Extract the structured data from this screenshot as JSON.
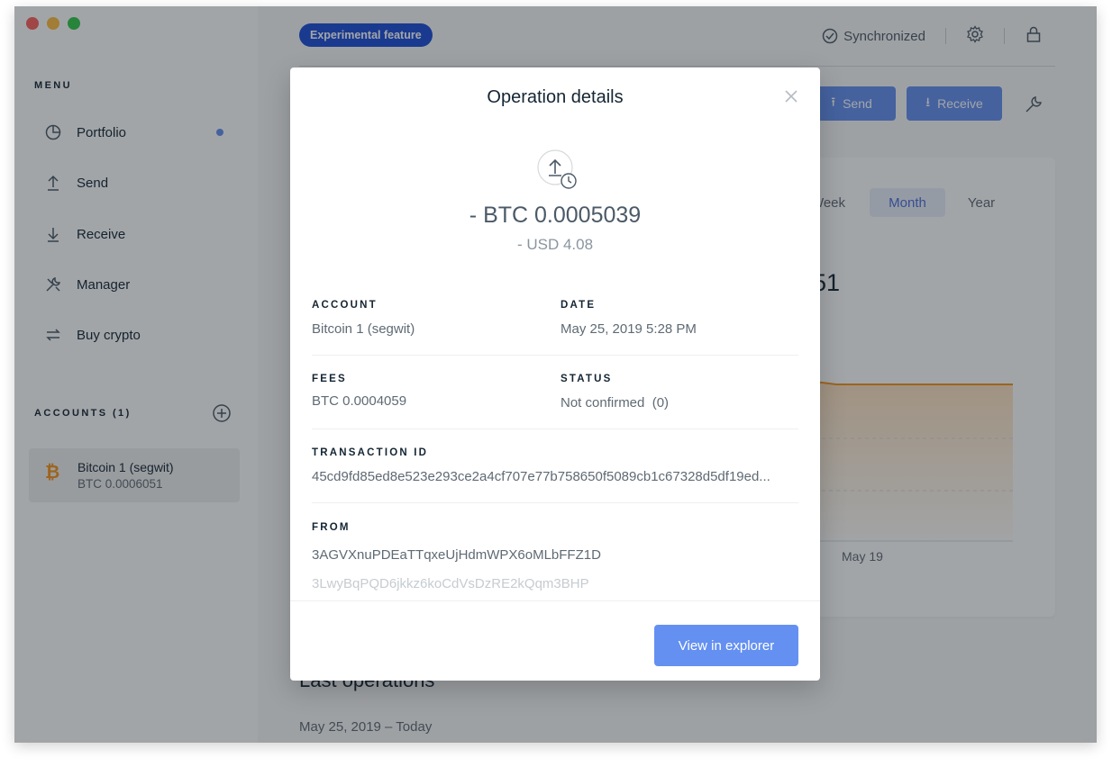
{
  "colors": {
    "accent": "#6490f1",
    "traffic_close": "#fc615d",
    "traffic_min": "#fdbc40",
    "traffic_max": "#34c84a",
    "bitcoin": "#f7931a",
    "chart_line": "#f7931a",
    "portfolio_dot": "#6490f1",
    "experimental_badge": "#1d4ed8"
  },
  "window": {
    "controls": [
      "close",
      "minimize",
      "maximize"
    ]
  },
  "sidebar": {
    "menu_title": "MENU",
    "items": [
      {
        "label": "Portfolio",
        "icon": "pie-chart-icon",
        "has_dot": true
      },
      {
        "label": "Send",
        "icon": "arrow-up-icon"
      },
      {
        "label": "Receive",
        "icon": "arrow-down-icon"
      },
      {
        "label": "Manager",
        "icon": "tools-icon"
      },
      {
        "label": "Buy crypto",
        "icon": "exchange-icon"
      }
    ],
    "accounts_title": "ACCOUNTS (1)",
    "add_account_icon": "plus-circle-icon",
    "accounts": [
      {
        "name": "Bitcoin 1 (segwit)",
        "balance": "BTC 0.0006051",
        "icon": "bitcoin-icon",
        "icon_glyph": "₿"
      }
    ]
  },
  "topbar": {
    "experimental_label": "Experimental feature",
    "sync_label": "Synchronized",
    "sync_icon": "check-circle-icon",
    "settings_icon": "gear-icon",
    "lock_icon": "lock-icon"
  },
  "actions": {
    "send_label": "Send",
    "receive_label": "Receive",
    "wrench_icon": "wrench-icon"
  },
  "chart": {
    "ranges": [
      "Week",
      "Month",
      "Year"
    ],
    "active_range": "Month",
    "balance_partial": "51",
    "tick_label": "May 19"
  },
  "chart_data": {
    "type": "area",
    "x": [
      "May 19"
    ],
    "series": [
      {
        "values": []
      }
    ]
  },
  "last_operations": {
    "title": "Last operations",
    "date_group": "May 25, 2019 – Today"
  },
  "modal": {
    "title": "Operation details",
    "close_icon": "close-icon",
    "operation_icon": "upload-pending-icon",
    "amount": "- BTC 0.0005039",
    "amount_fiat": "- USD 4.08",
    "account_label": "ACCOUNT",
    "account_value": "Bitcoin 1 (segwit)",
    "date_label": "DATE",
    "date_value": "May 25, 2019 5:28 PM",
    "fees_label": "FEES",
    "fees_value": "BTC 0.0004059",
    "status_label": "STATUS",
    "status_value": "Not confirmed  (0)",
    "txid_label": "TRANSACTION ID",
    "txid_value": "45cd9fd85ed8e523e293ce2a4cf707e77b758650f5089cb1c67328d5df19ed...",
    "from_label": "FROM",
    "from_values": [
      "3AGVXnuPDEaTTqxeUjHdmWPX6oMLbFFZ1D",
      "3LwyBqPQD6jkkz6koCdVsDzRE2kQqm3BHP"
    ],
    "explorer_button": "View in explorer"
  }
}
